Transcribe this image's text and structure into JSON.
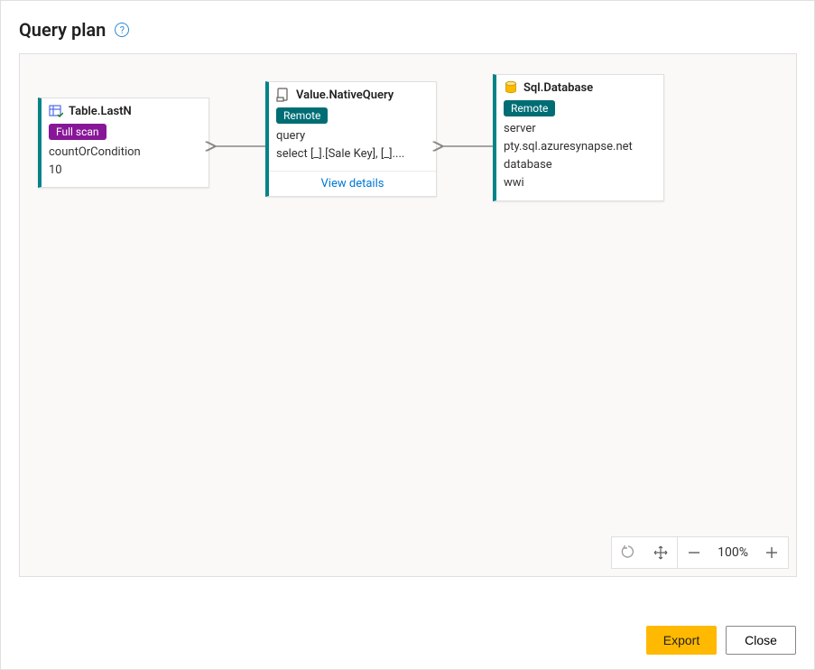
{
  "header": {
    "title": "Query plan",
    "help_glyph": "?"
  },
  "nodes": {
    "n1": {
      "title": "Table.LastN",
      "badge": "Full scan",
      "param_label": "countOrCondition",
      "param_value": "10"
    },
    "n2": {
      "title": "Value.NativeQuery",
      "badge": "Remote",
      "param_label": "query",
      "param_value": "select [_].[Sale Key], [_]....",
      "details_link": "View details"
    },
    "n3": {
      "title": "Sql.Database",
      "badge": "Remote",
      "p1_label": "server",
      "p1_value": "pty.sql.azuresynapse.net",
      "p2_label": "database",
      "p2_value": "wwi"
    }
  },
  "toolbar": {
    "zoom_pct": "100%"
  },
  "buttons": {
    "export": "Export",
    "close": "Close"
  }
}
